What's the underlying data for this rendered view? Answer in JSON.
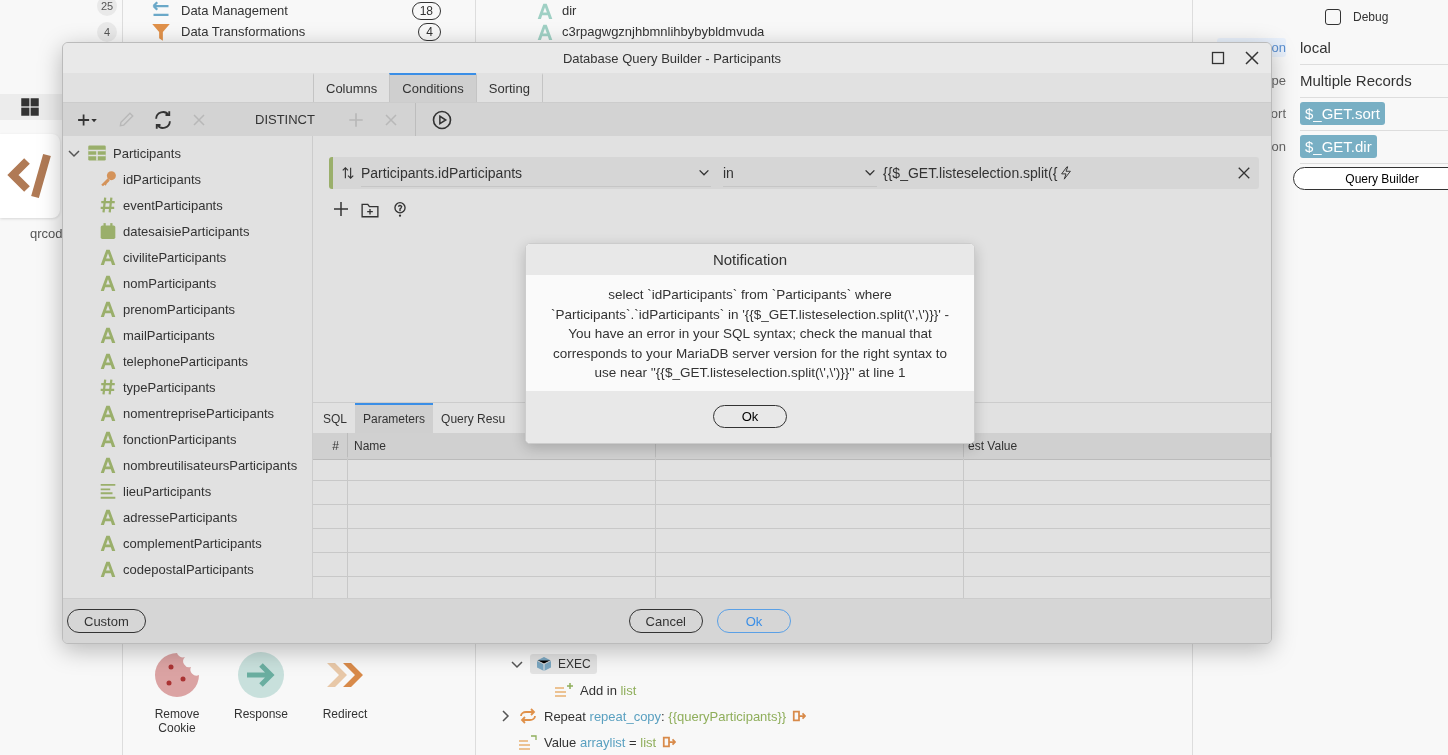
{
  "background": {
    "left_badges": [
      "25",
      "4"
    ],
    "sidebar_items": [
      {
        "kind": "data",
        "label": "Data Management",
        "count": "18"
      },
      {
        "kind": "filter",
        "label": "Data Transformations",
        "count": "4"
      }
    ],
    "tile_label": "qrcod",
    "fields": [
      "dir",
      "c3rpagwgznjhbmnlihbybybldmvuda"
    ],
    "actions": [
      {
        "kind": "cookie",
        "label": "Remove Cookie"
      },
      {
        "kind": "response",
        "label": "Response"
      },
      {
        "kind": "redirect",
        "label": "Redirect"
      }
    ],
    "flow": [
      {
        "kind": "exec",
        "label": "EXEC",
        "expanded": true,
        "children": [
          {
            "kind": "add",
            "parts": [
              {
                "kind": "plain",
                "text": "Add in "
              },
              {
                "kind": "value",
                "text": "list"
              }
            ]
          }
        ]
      },
      {
        "kind": "repeat",
        "expanded": false,
        "parts": [
          {
            "kind": "plain",
            "text": "Repeat "
          },
          {
            "kind": "name",
            "text": "repeat_copy"
          },
          {
            "kind": "plain",
            "text": ": "
          },
          {
            "kind": "value",
            "text": "{{queryParticipants}}"
          }
        ]
      },
      {
        "kind": "value",
        "parts": [
          {
            "kind": "plain",
            "text": "Value "
          },
          {
            "kind": "name",
            "text": "arraylist"
          },
          {
            "kind": "plain",
            "text": " = "
          },
          {
            "kind": "value",
            "text": "list"
          }
        ]
      }
    ],
    "properties": {
      "debug": {
        "label": "Debug",
        "checked": false
      },
      "rows": [
        {
          "label": "on",
          "value": "local",
          "kind": "text",
          "selected": true
        },
        {
          "label": "pe",
          "value": "Multiple Records",
          "kind": "text",
          "selected": false
        },
        {
          "label": "ort",
          "value": "$_GET.sort",
          "kind": "tag",
          "selected": false
        },
        {
          "label": "on",
          "value": "$_GET.dir",
          "kind": "tag",
          "selected": false
        }
      ],
      "button": "Query Builder"
    }
  },
  "dialog": {
    "title": "Database Query Builder - Participants",
    "tabs": [
      {
        "label": "Columns",
        "selected": false
      },
      {
        "label": "Conditions",
        "selected": true
      },
      {
        "label": "Sorting",
        "selected": false
      }
    ],
    "toolbar": [
      {
        "kind": "add-menu",
        "disabled": false
      },
      {
        "kind": "edit",
        "disabled": true
      },
      {
        "kind": "refresh",
        "disabled": false
      },
      {
        "kind": "delete",
        "disabled": true
      },
      {
        "kind": "text",
        "label": "DISTINCT",
        "disabled": false
      },
      {
        "kind": "add",
        "disabled": true
      },
      {
        "kind": "delete",
        "disabled": true
      },
      {
        "kind": "run",
        "disabled": false
      }
    ],
    "tree": {
      "label": "Participants",
      "expanded": true,
      "children": [
        {
          "kind": "key",
          "label": "idParticipants"
        },
        {
          "kind": "number",
          "label": "eventParticipants"
        },
        {
          "kind": "date",
          "label": "datesaisieParticipants"
        },
        {
          "kind": "text",
          "label": "civiliteParticipants"
        },
        {
          "kind": "text",
          "label": "nomParticipants"
        },
        {
          "kind": "text",
          "label": "prenomParticipants"
        },
        {
          "kind": "text",
          "label": "mailParticipants"
        },
        {
          "kind": "text",
          "label": "telephoneParticipants"
        },
        {
          "kind": "number",
          "label": "typeParticipants"
        },
        {
          "kind": "text",
          "label": "nomentrepriseParticipants"
        },
        {
          "kind": "text",
          "label": "fonctionParticipants"
        },
        {
          "kind": "text",
          "label": "nombreutilisateursParticipants"
        },
        {
          "kind": "longtext",
          "label": "lieuParticipants"
        },
        {
          "kind": "text",
          "label": "adresseParticipants"
        },
        {
          "kind": "text",
          "label": "complementParticipants"
        },
        {
          "kind": "text",
          "label": "codepostalParticipants"
        }
      ]
    },
    "condition": {
      "field": "Participants.idParticipants",
      "operator": "in",
      "value": "{{$_GET.listeselection.split({"
    },
    "bottom_tabs": [
      {
        "label": "SQL",
        "selected": false
      },
      {
        "label": "Parameters",
        "selected": true
      },
      {
        "label": "Query Resu",
        "selected": false
      }
    ],
    "table": {
      "columns": [
        "#",
        "Name",
        "est Value"
      ]
    },
    "buttons": [
      {
        "label": "Custom",
        "kind": "default"
      },
      {
        "label": "Cancel",
        "kind": "default"
      },
      {
        "label": "Ok",
        "kind": "primary"
      }
    ]
  },
  "notification": {
    "title": "Notification",
    "message": "select `idParticipants` from `Participants` where `Participants`.`idParticipants` in '{{$_GET.listeselection.split(\\',\\')}}' - You have an error in your SQL syntax; check the manual that corresponds to your MariaDB server version for the right syntax to use near ''{{$_GET.listeselection.split(\\',\\')}}'' at line 1",
    "button": "Ok"
  }
}
